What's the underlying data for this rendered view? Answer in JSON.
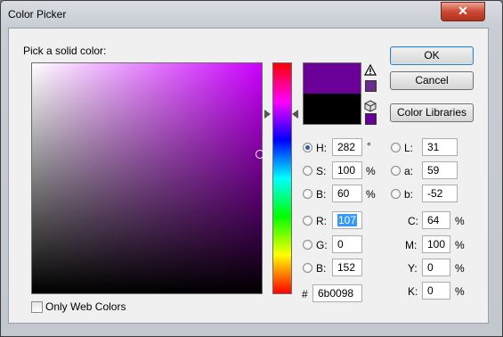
{
  "window": {
    "title": "Color Picker",
    "close_glyph": "✕"
  },
  "prompt": "Pick a solid color:",
  "colors": {
    "hue": "#cc00ff",
    "new": "#6b0098",
    "current": "#000000",
    "websafe": "#660099"
  },
  "buttons": {
    "ok": "OK",
    "cancel": "Cancel",
    "libraries": "Color Libraries"
  },
  "hsb": {
    "h": {
      "label": "H:",
      "value": "282",
      "unit": "°"
    },
    "s": {
      "label": "S:",
      "value": "100",
      "unit": "%"
    },
    "b": {
      "label": "B:",
      "value": "60",
      "unit": "%"
    }
  },
  "rgb": {
    "r": {
      "label": "R:",
      "value": "107"
    },
    "g": {
      "label": "G:",
      "value": "0"
    },
    "b": {
      "label": "B:",
      "value": "152"
    }
  },
  "lab": {
    "l": {
      "label": "L:",
      "value": "31"
    },
    "a": {
      "label": "a:",
      "value": "59"
    },
    "b": {
      "label": "b:",
      "value": "-52"
    }
  },
  "cmyk": {
    "c": {
      "label": "C:",
      "value": "64",
      "unit": "%"
    },
    "m": {
      "label": "M:",
      "value": "100",
      "unit": "%"
    },
    "y": {
      "label": "Y:",
      "value": "0",
      "unit": "%"
    },
    "k": {
      "label": "K:",
      "value": "0",
      "unit": "%"
    }
  },
  "hex": {
    "label": "#",
    "value": "6b0098"
  },
  "web_only": {
    "label": "Only Web Colors",
    "checked": false
  }
}
